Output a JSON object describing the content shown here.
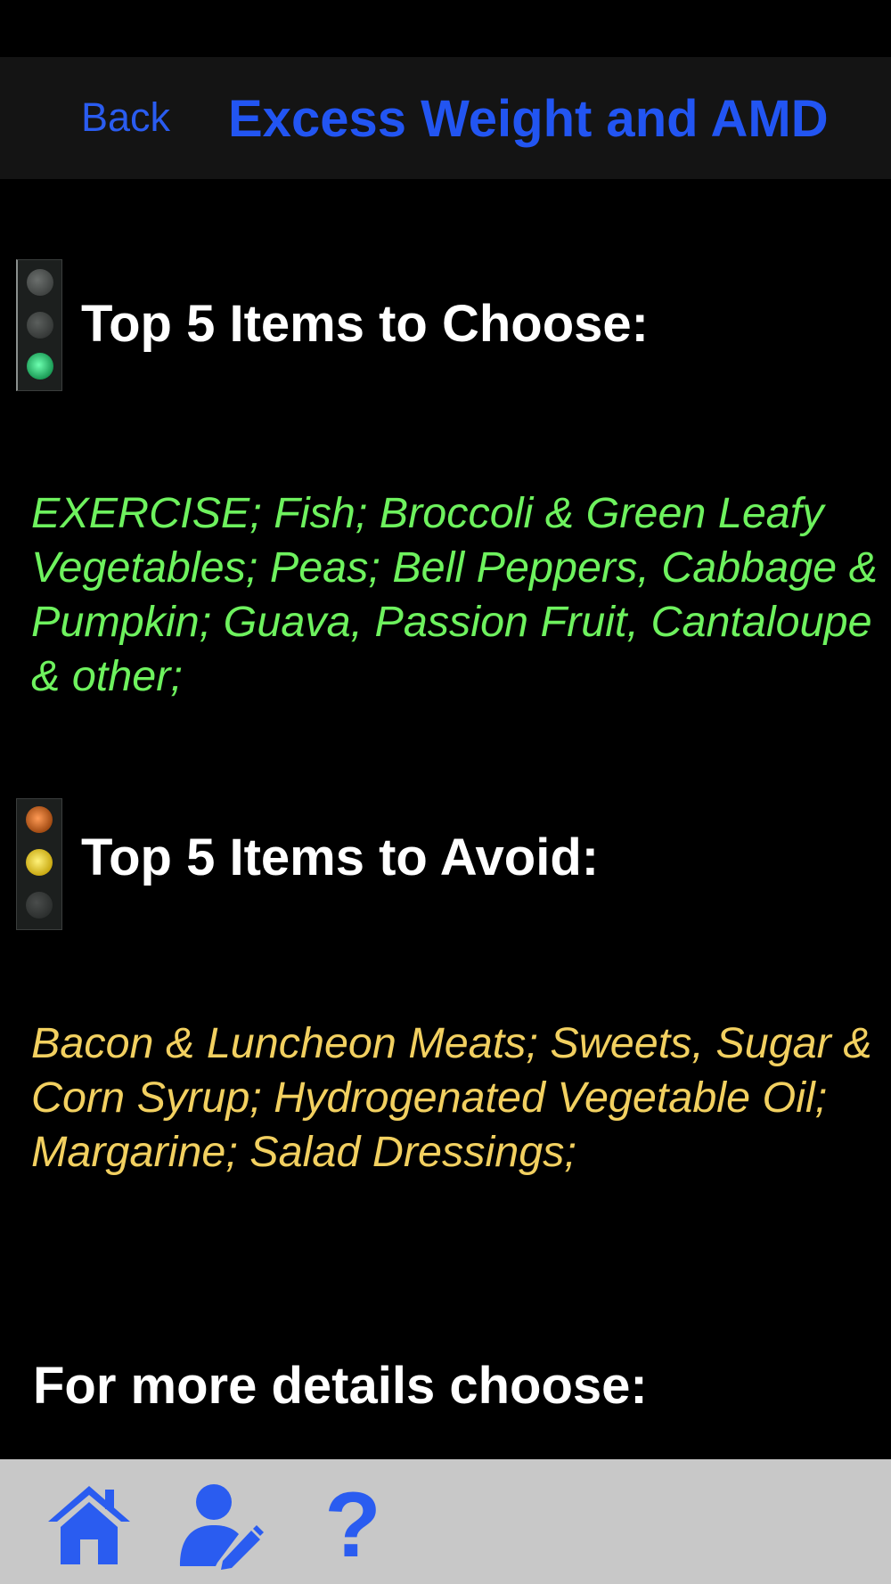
{
  "nav": {
    "back_label": "Back",
    "title": "Excess Weight and AMD"
  },
  "choose_section": {
    "icon": "green-traffic-light-icon",
    "heading": "Top 5 Items to Choose:",
    "items_text": "EXERCISE; Fish; Broccoli & Green Leafy Vegetables; Peas; Bell Peppers, Cabbage & Pumpkin; Guava, Passion Fruit, Cantaloupe & other;",
    "color": "#6ef25e"
  },
  "avoid_section": {
    "icon": "amber-traffic-light-icon",
    "heading": "Top 5 Items to Avoid:",
    "items_text": "Bacon & Luncheon Meats; Sweets, Sugar & Corn Syrup; Hydrogenated Vegetable Oil; Margarine; Salad Dressings;",
    "color": "#f2d060"
  },
  "more_details": {
    "label": "For more details choose:"
  },
  "tab_bar": {
    "items": [
      {
        "icon": "home-icon"
      },
      {
        "icon": "user-edit-icon"
      },
      {
        "icon": "help-icon",
        "glyph": "?"
      }
    ]
  },
  "colors": {
    "accent": "#2a5cf0",
    "nav_background": "#141414",
    "page_background": "#000000",
    "tab_bar_background": "#c8c8c8"
  }
}
